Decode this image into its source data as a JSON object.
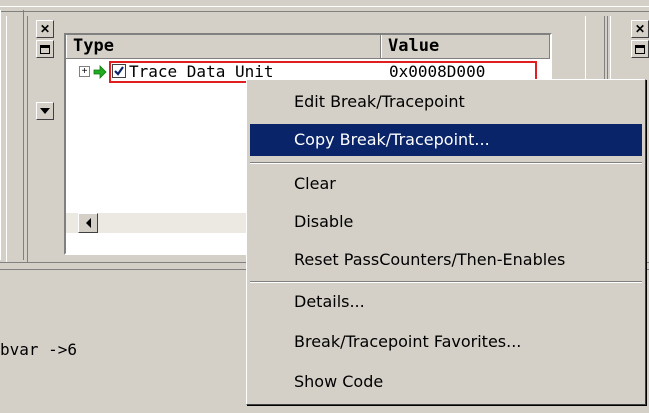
{
  "grid": {
    "columns": [
      "Type",
      "Value"
    ],
    "row": {
      "checked": true,
      "type_text": "Trace Data Unit",
      "value_text": "0x0008D000"
    }
  },
  "console": {
    "line": "bvar ->6"
  },
  "icons": {
    "pane_close": "close-icon",
    "pane_restore": "restore-icon",
    "pane_menu": "dropdown-arrow-icon",
    "expand": "plus-box-icon",
    "current": "green-arrow-icon",
    "scroll_left": "scroll-left-arrow-icon"
  },
  "context_menu": {
    "items": [
      {
        "label": "Edit Break/Tracepoint"
      },
      {
        "label": "Copy Break/Tracepoint...",
        "highlighted": true
      },
      {
        "label": "Clear"
      },
      {
        "label": "Disable"
      },
      {
        "label": "Reset PassCounters/Then-Enables"
      },
      {
        "label": "Details..."
      },
      {
        "label": "Break/Tracepoint Favorites..."
      },
      {
        "label": "Show Code"
      }
    ]
  },
  "colors": {
    "selection": "#0a246a",
    "face": "#d4d0c8",
    "row_highlight_border": "#e02020",
    "arrow": "#22aa22"
  }
}
